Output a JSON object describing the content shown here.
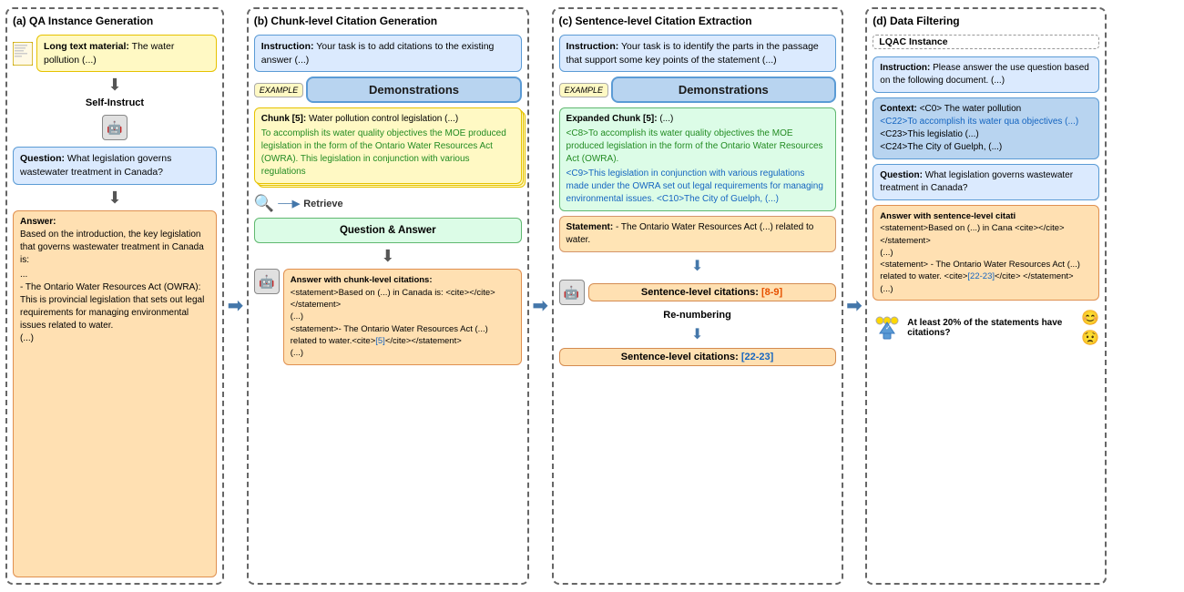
{
  "sections": {
    "a": {
      "title": "(a) QA Instance Generation",
      "doc_box": {
        "label": "Long text material:",
        "text": "The water pollution (...)"
      },
      "self_instruct": "Self-Instruct",
      "question_box": {
        "label": "Question:",
        "text": "What legislation governs wastewater treatment in Canada?"
      },
      "answer_box": {
        "label": "Answer:",
        "text": "Based on the introduction, the key legislation that governs wastewater treatment in Canada is:",
        "list": "...\n- The Ontario Water Resources Act (OWRA): This is provincial legislation that sets out legal requirements for managing environmental issues related to water.\n(...)"
      }
    },
    "b": {
      "title": "(b) Chunk-level Citation Generation",
      "instruction_box": {
        "label": "Instruction:",
        "text": "Your task is to add citations to the existing answer (...)"
      },
      "demonstrations": "Demonstrations",
      "chunk_box": {
        "label": "Chunk [5]:",
        "text": "Water pollution control legislation (...)",
        "highlight": "To accomplish its water quality objectives the MOE produced legislation in the form of the Ontario Water Resources Act (OWRA).  This legislation in conjunction with various regulations"
      },
      "qa_label": "Question & Answer",
      "retrieve_label": "Retrieve",
      "answer_chunk_box": {
        "label": "Answer with chunk-level citations:",
        "text": "<statement>Based on (...) in Canada is: <cite></cite></statement>\n(...)\n<statement>- The Ontario Water Resources Act (...) related to water.<cite>[5]</cite></statement>\n(...)"
      }
    },
    "c": {
      "title": "(c) Sentence-level Citation Extraction",
      "instruction_box": {
        "label": "Instruction:",
        "text": "Your task is to identify the parts in the passage that support some key points of the statement (...)"
      },
      "demonstrations": "Demonstrations",
      "expanded_chunk_box": {
        "label": "Expanded Chunk [5]:",
        "prefix": "(...)",
        "c8": "<C8>To accomplish its water quality objectives the MOE produced legislation in the form of the Ontario Water Resources Act (OWRA).",
        "c9": "<C9>This legislation in conjunction with various regulations made under the OWRA set out legal requirements for managing environmental issues.",
        "c10": "<C10>The City of Guelph, (...)"
      },
      "statement_box": {
        "label": "Statement:",
        "text": "- The Ontario Water Resources Act (...) related to water."
      },
      "sent_citations_1": {
        "label": "Sentence-level citations:",
        "value": "[8-9]"
      },
      "renumbering": "Re-numbering",
      "sent_citations_2": {
        "label": "Sentence-level citations:",
        "value": "[22-23]"
      }
    },
    "d": {
      "title": "(d) Data Filtering",
      "lqac_label": "LQAC Instance",
      "instruction_box": {
        "label": "Instruction:",
        "text": "Please answer the use question based on the following document. (...)"
      },
      "context_box": {
        "label": "Context:",
        "c0": "<C0> The water pollution",
        "c22": "<C22>To accomplish its water qua objectives (...)",
        "c23": "<C23>This legislatio (...)",
        "c24": "<C24>The City of Guelph, (...)"
      },
      "question_box": {
        "label": "Question:",
        "text": "What legislation governs wastewater treatment in Canada?"
      },
      "answer_box": {
        "label": "Answer with sentence-level citati",
        "text": "<statement>Based on (...) in Cana <cite></cite></statement>\n(...)\n<statement> - The Ontario Water Resources Act (...) related to water. <cite>[22-23]</cite> </statement>\n(...)"
      },
      "filter_question": "At least 20% of the statements have citations?",
      "yes_icon": "😊",
      "no_icon": "😟"
    }
  }
}
